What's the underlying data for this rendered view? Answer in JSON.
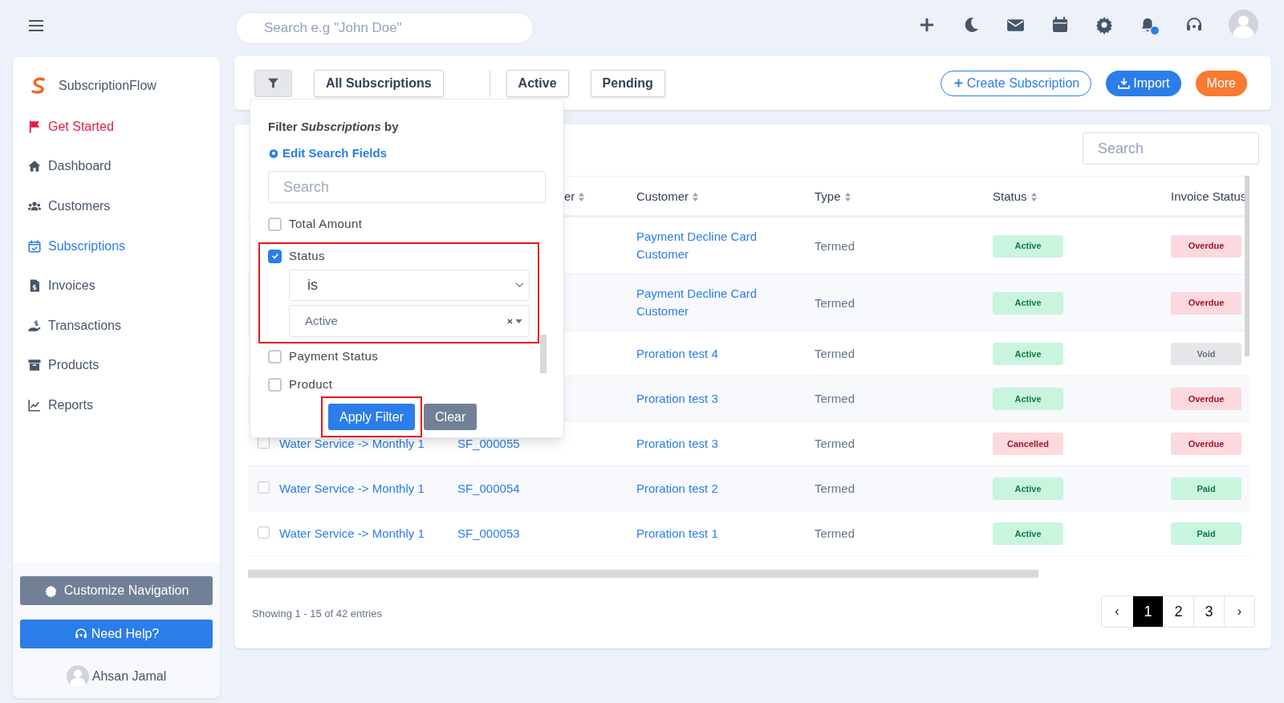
{
  "topbar": {
    "search_placeholder": "Search e.g \"John Doe\""
  },
  "sidebar": {
    "brand": "SubscriptionFlow",
    "items": [
      {
        "label": "Get Started",
        "selected": false,
        "kind": "highlight"
      },
      {
        "label": "Dashboard",
        "selected": false,
        "kind": "normal"
      },
      {
        "label": "Customers",
        "selected": false,
        "kind": "normal"
      },
      {
        "label": "Subscriptions",
        "selected": true,
        "kind": "normal"
      },
      {
        "label": "Invoices",
        "selected": false,
        "kind": "normal"
      },
      {
        "label": "Transactions",
        "selected": false,
        "kind": "normal"
      },
      {
        "label": "Products",
        "selected": false,
        "kind": "normal"
      },
      {
        "label": "Reports",
        "selected": false,
        "kind": "normal"
      }
    ],
    "customize_button": "Customize Navigation",
    "help_button": "Need Help?",
    "user": "Ahsan Jamal"
  },
  "toolbar": {
    "views": [
      {
        "label": "All Subscriptions",
        "selected": false
      },
      {
        "label": "Active",
        "selected": false
      },
      {
        "label": "Pending",
        "selected": false
      }
    ],
    "actions": [
      {
        "label": "Create Subscription",
        "kind": "outline"
      },
      {
        "label": "Import",
        "kind": "primary"
      },
      {
        "label": "More",
        "kind": "accent"
      }
    ]
  },
  "filter_popup": {
    "title": "Filter *Subscriptions* by",
    "edit_link": "Edit Search Fields",
    "search_placeholder": "Search",
    "fields": [
      {
        "label": "Total Amount",
        "checked": false,
        "highlighted": false
      },
      {
        "label": "Status",
        "checked": true,
        "highlighted": true,
        "operator": "is",
        "value": "Active"
      },
      {
        "label": "Payment Status",
        "checked": false,
        "highlighted": false
      },
      {
        "label": "Product",
        "checked": false,
        "highlighted": false
      }
    ],
    "apply_button": "Apply Filter",
    "apply_highlighted": true,
    "clear_button": "Clear"
  },
  "table": {
    "search_placeholder": "Search",
    "columns": [
      {
        "label": "er"
      },
      {
        "label": "Customer"
      },
      {
        "label": "Type"
      },
      {
        "label": "Status"
      },
      {
        "label": "Invoice Status"
      }
    ],
    "rows": [
      {
        "customer": "Payment Decline Card Customer",
        "type": "Termed",
        "status": {
          "label": "Active",
          "kind": "success"
        },
        "invoice_status": {
          "label": "Overdue",
          "kind": "danger"
        }
      },
      {
        "customer": "Payment Decline Card Customer",
        "type": "Termed",
        "status": {
          "label": "Active",
          "kind": "success"
        },
        "invoice_status": {
          "label": "Overdue",
          "kind": "danger"
        }
      },
      {
        "customer": "Proration test 4",
        "type": "Termed",
        "status": {
          "label": "Active",
          "kind": "success"
        },
        "invoice_status": {
          "label": "Void",
          "kind": "neutral"
        }
      },
      {
        "customer": "Proration test 3",
        "type": "Termed",
        "status": {
          "label": "Active",
          "kind": "success"
        },
        "invoice_status": {
          "label": "Overdue",
          "kind": "danger"
        }
      },
      {
        "checked": false,
        "product": "Water Service -> Monthly 1",
        "number": "SF_000055",
        "customer": "Proration test 3",
        "type": "Termed",
        "status": {
          "label": "Cancelled",
          "kind": "danger"
        },
        "invoice_status": {
          "label": "Overdue",
          "kind": "danger"
        }
      },
      {
        "checked": false,
        "product": "Water Service -> Monthly 1",
        "number": "SF_000054",
        "customer": "Proration test 2",
        "type": "Termed",
        "status": {
          "label": "Active",
          "kind": "success"
        },
        "invoice_status": {
          "label": "Paid",
          "kind": "success"
        }
      },
      {
        "checked": false,
        "product": "Water Service -> Monthly 1",
        "number": "SF_000053",
        "customer": "Proration test 1",
        "type": "Termed",
        "status": {
          "label": "Active",
          "kind": "success"
        },
        "invoice_status": {
          "label": "Paid",
          "kind": "success"
        }
      }
    ],
    "summary": "Showing 1 - 15 of 42 entries",
    "pagination": [
      {
        "label": "‹",
        "kind": "prev",
        "selected": false
      },
      {
        "label": "1",
        "kind": "page",
        "selected": true
      },
      {
        "label": "2",
        "kind": "page",
        "selected": false
      },
      {
        "label": "3",
        "kind": "page",
        "selected": false
      },
      {
        "label": "›",
        "kind": "next",
        "selected": false
      }
    ]
  }
}
